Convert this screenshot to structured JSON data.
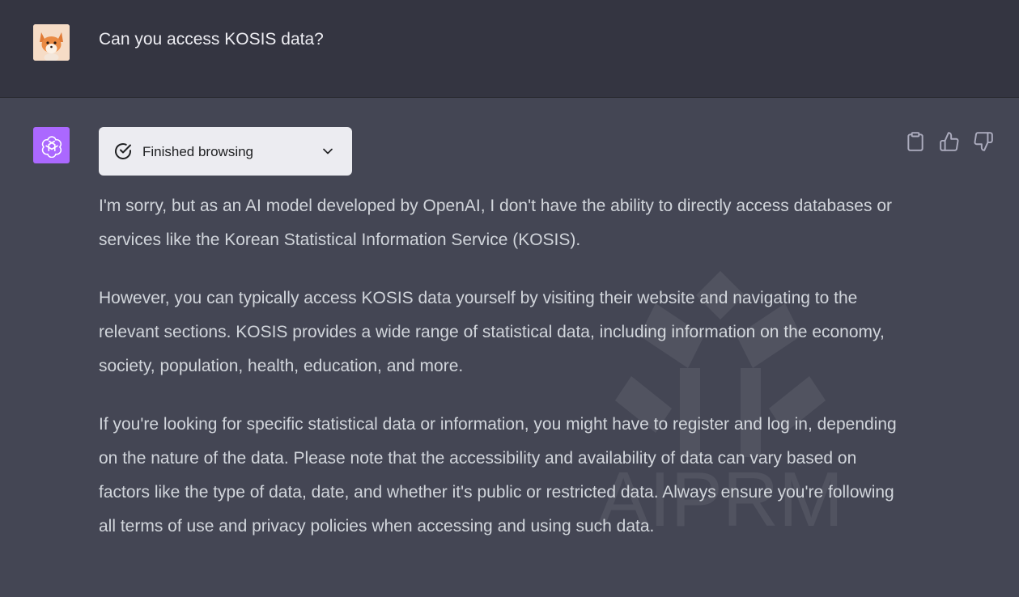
{
  "user_message": {
    "avatar": "fox-avatar",
    "text": "Can you access KOSIS data?"
  },
  "assistant_message": {
    "avatar": "openai-logo-icon",
    "avatar_color": "#ab68ff",
    "browse_status": {
      "label": "Finished browsing",
      "icon": "check-circle-icon",
      "dropdown_icon": "chevron-down-icon"
    },
    "actions": [
      "clipboard-icon",
      "thumbs-up-icon",
      "thumbs-down-icon"
    ],
    "paragraphs": [
      "I'm sorry, but as an AI model developed by OpenAI, I don't have the ability to directly access databases or services like the Korean Statistical Information Service (KOSIS).",
      "However, you can typically access KOSIS data yourself by visiting their website and navigating to the relevant sections. KOSIS provides a wide range of statistical data, including information on the economy, society, population, health, education, and more.",
      "If you're looking for specific statistical data or information, you might have to register and log in, depending on the nature of the data. Please note that the accessibility and availability of data can vary based on factors like the type of data, date, and whether it's public or restricted data. Always ensure you're following all terms of use and privacy policies when accessing and using such data."
    ]
  },
  "watermark": {
    "text": "AIPRM"
  },
  "colors": {
    "user_row_bg": "#343541",
    "assistant_row_bg": "#444654",
    "pill_bg": "#ececf1",
    "text": "#d1d5db"
  }
}
